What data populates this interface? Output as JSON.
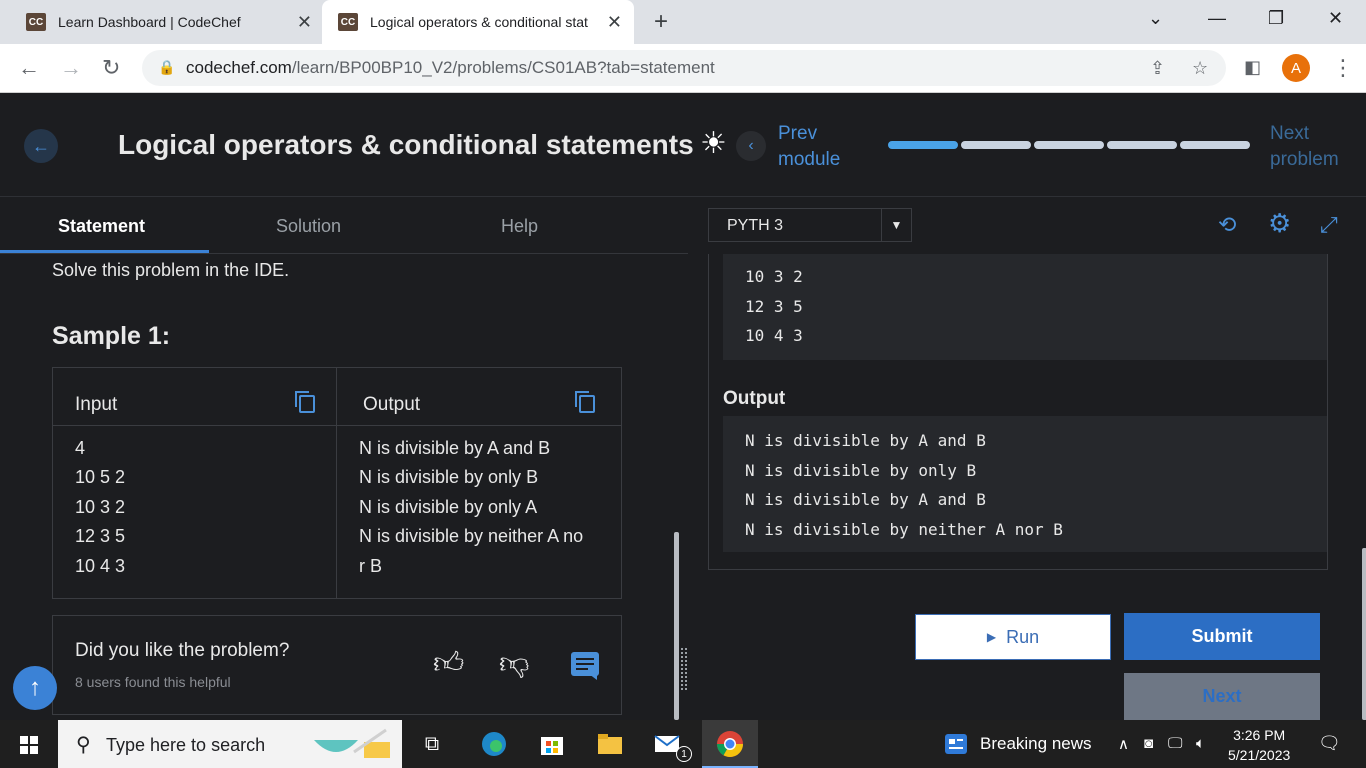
{
  "browser": {
    "tabs": [
      {
        "title": "Learn Dashboard | CodeChef",
        "favicon": "CC"
      },
      {
        "title": "Logical operators & conditional stat",
        "favicon": "CC"
      }
    ],
    "url_host": "codechef.com",
    "url_path": "/learn/BP00BP10_V2/problems/CS01AB?tab=statement",
    "profile_initial": "A"
  },
  "header": {
    "title": "Logical operators & conditional statements",
    "prev_line1": "Prev",
    "prev_line2": "module",
    "next_line1": "Next",
    "next_line2": "problem",
    "progress_segments": 5,
    "progress_done": 1
  },
  "left": {
    "tabs": [
      "Statement",
      "Solution",
      "Help"
    ],
    "intro": "Solve this problem in the IDE.",
    "sample_title": "Sample 1:",
    "input_label": "Input",
    "output_label": "Output",
    "input_lines": [
      "4",
      "10 5 2",
      "10 3 2",
      "12 3 5",
      "10 4 3"
    ],
    "output_lines": [
      "N is divisible by A and B",
      "N is divisible by only B",
      "N is divisible by only A",
      "N is divisible by neither A no",
      "r B"
    ],
    "feedback_question": "Did you like the problem?",
    "feedback_count": "8 users found this helpful"
  },
  "right": {
    "language": "PYTH 3",
    "input_tail": [
      "10 3 2",
      "12 3 5",
      "10 4 3"
    ],
    "output_label": "Output",
    "output_lines": [
      "N is divisible by A and B",
      "N is divisible by only B",
      "N is divisible by A and B",
      "N is divisible by neither A nor B"
    ],
    "run_label": "Run",
    "submit_label": "Submit",
    "next_label": "Next"
  },
  "taskbar": {
    "search_placeholder": "Type here to search",
    "news": "Breaking news",
    "time": "3:26 PM",
    "date": "5/21/2023",
    "mail_badge": "1"
  },
  "colors": {
    "accent": "#3b82d6",
    "page_bg": "#1c1d20",
    "progress_done": "#4aa3e8",
    "progress_todo": "#c9d3e0"
  }
}
